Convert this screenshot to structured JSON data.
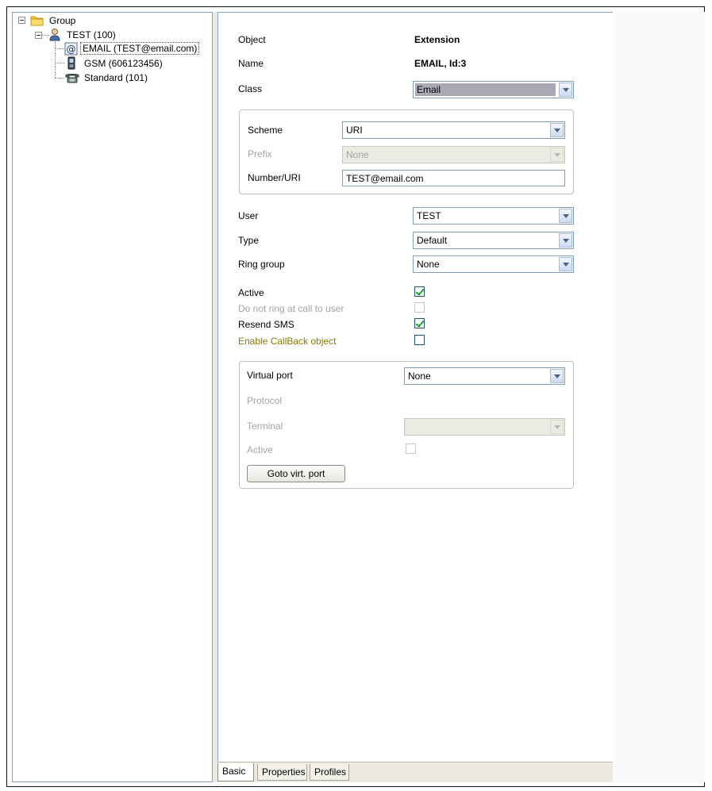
{
  "tree": {
    "root": {
      "label": "Group"
    },
    "user": {
      "label": "TEST (100)"
    },
    "extensions": [
      {
        "label": "EMAIL (TEST@email.com)",
        "icon": "email-icon",
        "selected": true
      },
      {
        "label": "GSM (606123456)",
        "icon": "mobile-phone-icon",
        "selected": false
      },
      {
        "label": "Standard (101)",
        "icon": "desk-phone-icon",
        "selected": false
      }
    ]
  },
  "details": {
    "object_label": "Object",
    "object_value": "Extension",
    "name_label": "Name",
    "name_value": "EMAIL, Id:3",
    "class_label": "Class",
    "class_value": "Email"
  },
  "address": {
    "scheme_label": "Scheme",
    "scheme_value": "URI",
    "prefix_label": "Prefix",
    "prefix_value": "None",
    "number_label": "Number/URI",
    "number_value": "TEST@email.com"
  },
  "assignment": {
    "user_label": "User",
    "user_value": "TEST",
    "type_label": "Type",
    "type_value": "Default",
    "ring_label": "Ring group",
    "ring_value": "None"
  },
  "flags": {
    "active_label": "Active",
    "active_checked": true,
    "dnr_label": "Do not ring at call to user",
    "dnr_checked": false,
    "resend_label": "Resend SMS",
    "resend_checked": true,
    "callback_label": "Enable CallBack object",
    "callback_checked": false
  },
  "virtual_port": {
    "vport_label": "Virtual port",
    "vport_value": "None",
    "protocol_label": "Protocol",
    "terminal_label": "Terminal",
    "terminal_value": "",
    "active_label": "Active",
    "goto_label": "Goto virt. port"
  },
  "tabs": [
    {
      "label": "Basic",
      "active": true
    },
    {
      "label": "Properties",
      "active": false
    },
    {
      "label": "Profiles",
      "active": false
    }
  ],
  "colors": {
    "disabled_text": "#a3a3a3",
    "callback_text": "#8a7a00",
    "check_mark": "#21a121",
    "border_blue": "#7f9db9"
  }
}
